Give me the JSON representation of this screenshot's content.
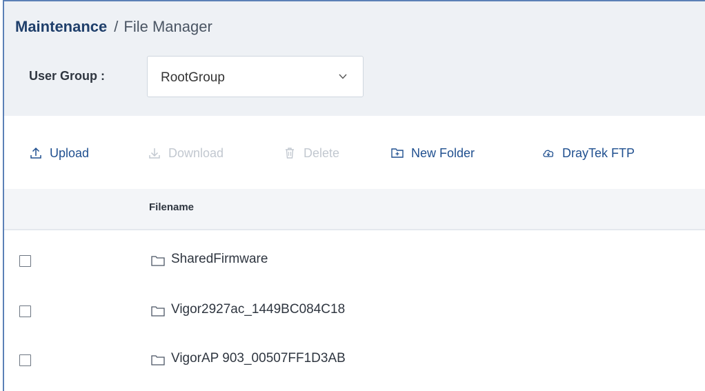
{
  "breadcrumb": {
    "root": "Maintenance",
    "separator": "/",
    "current": "File Manager"
  },
  "user_group": {
    "label": "User Group :",
    "selected": "RootGroup"
  },
  "toolbar": {
    "upload": {
      "label": "Upload",
      "icon": "upload-icon",
      "enabled": true
    },
    "download": {
      "label": "Download",
      "icon": "download-icon",
      "enabled": false
    },
    "delete": {
      "label": "Delete",
      "icon": "trash-icon",
      "enabled": false
    },
    "new_folder": {
      "label": "New Folder",
      "icon": "new-folder-icon",
      "enabled": true
    },
    "draytek_ftp": {
      "label": "DrayTek FTP",
      "icon": "cloud-download-icon",
      "enabled": true
    }
  },
  "table": {
    "columns": [
      "Filename"
    ],
    "rows": [
      {
        "name": "SharedFirmware",
        "type": "folder",
        "checked": false
      },
      {
        "name": "Vigor2927ac_1449BC084C18",
        "type": "folder",
        "checked": false
      },
      {
        "name": "VigorAP 903_00507FF1D3AB",
        "type": "folder",
        "checked": false
      }
    ]
  },
  "colors": {
    "accent": "#1f4f8f",
    "disabled": "#c2c8d0",
    "header_bg": "#eef1f5",
    "frame_border": "#5b80b6"
  }
}
